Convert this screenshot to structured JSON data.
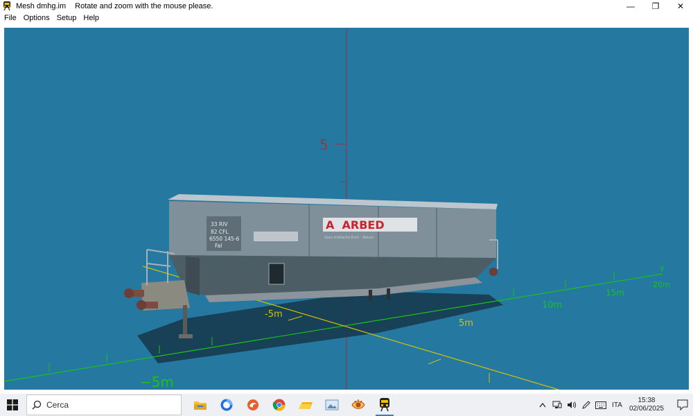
{
  "window": {
    "title": "Mesh dmhg.im",
    "hint": "Rotate and zoom with the mouse please.",
    "minimize_glyph": "—",
    "restore_glyph": "❐",
    "close_glyph": "✕"
  },
  "menu": [
    "File",
    "Options",
    "Setup",
    "Help"
  ],
  "viewport": {
    "background": "#2578a0",
    "axis_labels": {
      "z_5": "5",
      "x_neg5": "-5m",
      "x_5": "5m",
      "x_10": "10m",
      "x_15": "15m",
      "x_20": "20m",
      "y_axis": "Y",
      "y_neg5": "-5m",
      "y_minus5": "−5m"
    },
    "wagon": {
      "plate_lines": [
        "33 RIV",
        "82 CFL",
        "6550 145-6",
        "Fal"
      ],
      "brand": "A  ARBED",
      "small_text": "Gare d'attache Esch - Belval"
    }
  },
  "taskbar": {
    "search_placeholder": "Cerca",
    "apps": [
      "file-explorer-icon",
      "firefox-icon",
      "scratch-icon",
      "chrome-icon",
      "folder-app-icon",
      "photos-icon",
      "eye-app-icon",
      "train-app-icon"
    ],
    "language": "ITA",
    "time": "15:38",
    "date": "02/06/2025"
  }
}
